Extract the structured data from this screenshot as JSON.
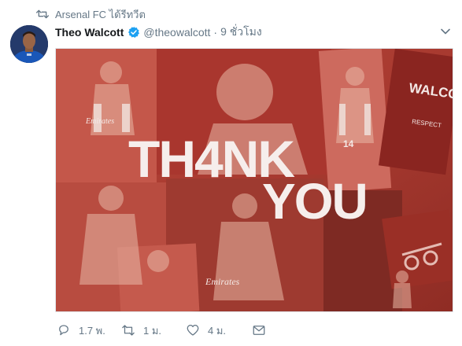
{
  "retweet_context": {
    "text": "Arsenal FC ได้รีทวีต",
    "icon": "retweet-icon"
  },
  "tweet": {
    "author_name": "Theo Walcott",
    "handle": "@theowalcott",
    "separator": "·",
    "time": "9 ชั่วโมง",
    "verified_icon": "verified-badge-icon",
    "media": {
      "headline_line1": "TH4NK",
      "headline_line2": "YOU",
      "shirt_text": "WALCOTT",
      "sleeve_text": "RESPECT",
      "brand_text": "Emirates",
      "number_text": "14",
      "tint_color": "#c0392b"
    }
  },
  "actions": {
    "reply": {
      "count": "1.7 พ.",
      "icon": "reply-icon"
    },
    "retweet": {
      "count": "1 ม.",
      "icon": "retweet-icon"
    },
    "like": {
      "count": "4 ม.",
      "icon": "heart-icon"
    },
    "message": {
      "icon": "envelope-icon"
    }
  },
  "colors": {
    "accent": "#1da1f2",
    "muted": "#657786",
    "text": "#14171a"
  }
}
